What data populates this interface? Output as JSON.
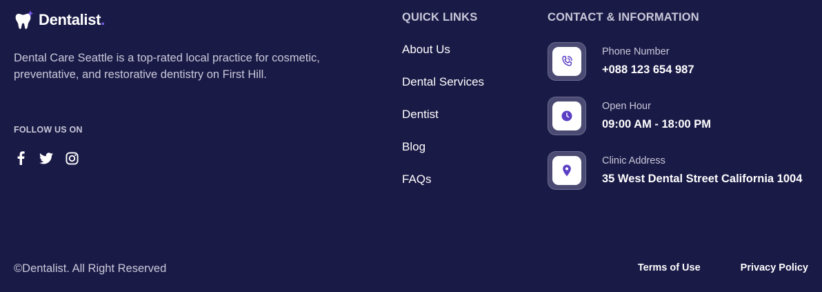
{
  "brand": {
    "name": "Dentalist",
    "dot": ".",
    "accent_color": "#7b5cf0",
    "logo_icon": "tooth-icon"
  },
  "about": {
    "text": "Dental Care Seattle is a top-rated local practice for cosmetic, preventative, and restorative dentistry on First Hill."
  },
  "social": {
    "label": "FOLLOW US ON",
    "icons": [
      "facebook-icon",
      "twitter-icon",
      "instagram-icon"
    ]
  },
  "quick_links": {
    "title": "QUICK LINKS",
    "items": [
      {
        "label": "About Us"
      },
      {
        "label": "Dental Services"
      },
      {
        "label": "Dentist"
      },
      {
        "label": "Blog"
      },
      {
        "label": "FAQs"
      }
    ]
  },
  "contact": {
    "title": "CONTACT & INFORMATION",
    "items": [
      {
        "label": "Phone Number",
        "value": "+088 123 654 987",
        "icon": "phone-icon"
      },
      {
        "label": "Open Hour",
        "value": "09:00 AM - 18:00 PM",
        "icon": "clock-icon"
      },
      {
        "label": "Clinic Address",
        "value": "35 West Dental Street California 1004",
        "icon": "location-pin-icon"
      }
    ]
  },
  "bottom": {
    "copyright": "©Dentalist. All Right Reserved",
    "terms_label": "Terms of Use",
    "privacy_label": "Privacy Policy"
  },
  "colors": {
    "background": "#1a1a47",
    "icon_color": "#5b3fc4",
    "muted_text": "#c9c9da"
  }
}
